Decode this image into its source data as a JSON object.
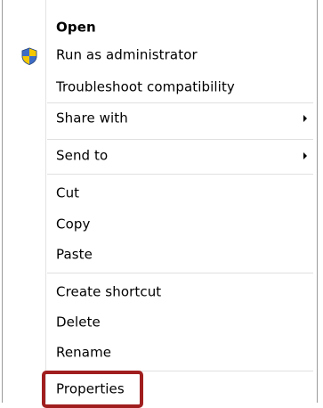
{
  "context_menu": {
    "items": [
      {
        "label": "Open",
        "bold": true,
        "icon": null,
        "submenu": false
      },
      {
        "label": "Run as administrator",
        "bold": false,
        "icon": "uac-shield-icon",
        "submenu": false
      },
      {
        "label": "Troubleshoot compatibility",
        "bold": false,
        "icon": null,
        "submenu": false
      },
      {
        "label": "Share with",
        "bold": false,
        "icon": null,
        "submenu": true
      },
      {
        "label": "Send to",
        "bold": false,
        "icon": null,
        "submenu": true
      },
      {
        "label": "Cut",
        "bold": false,
        "icon": null,
        "submenu": false
      },
      {
        "label": "Copy",
        "bold": false,
        "icon": null,
        "submenu": false
      },
      {
        "label": "Paste",
        "bold": false,
        "icon": null,
        "submenu": false
      },
      {
        "label": "Create shortcut",
        "bold": false,
        "icon": null,
        "submenu": false
      },
      {
        "label": "Delete",
        "bold": false,
        "icon": null,
        "submenu": false
      },
      {
        "label": "Rename",
        "bold": false,
        "icon": null,
        "submenu": false
      },
      {
        "label": "Properties",
        "bold": false,
        "icon": null,
        "submenu": false
      }
    ],
    "highlighted_item": "Properties"
  },
  "colors": {
    "highlight_border": "#a01e1e",
    "separator": "#e0e0e0",
    "text": "#000000"
  }
}
